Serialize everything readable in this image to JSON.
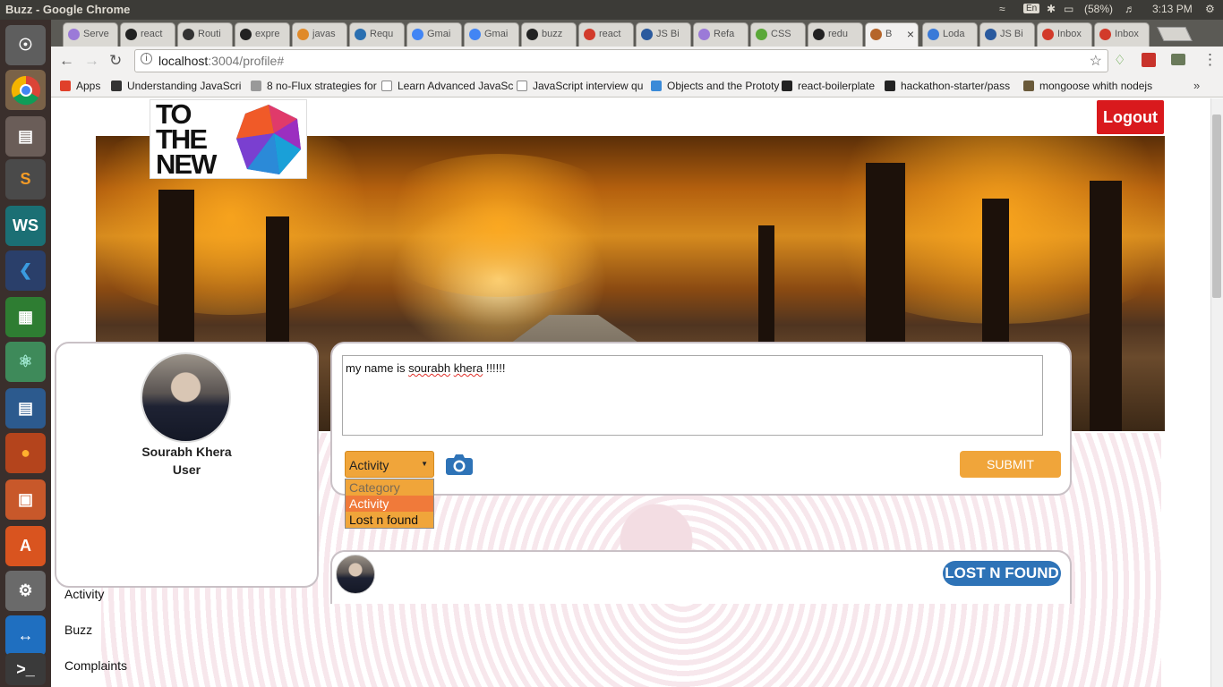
{
  "window": {
    "title": "Buzz - Google Chrome"
  },
  "indicators": {
    "lang": "En",
    "battery": "(58%)",
    "clock": "3:13 PM"
  },
  "tabs": [
    {
      "label": "Serve"
    },
    {
      "label": "react"
    },
    {
      "label": "Routi"
    },
    {
      "label": "expre"
    },
    {
      "label": "javas"
    },
    {
      "label": "Requ"
    },
    {
      "label": "Gmai"
    },
    {
      "label": "Gmai"
    },
    {
      "label": "buzz"
    },
    {
      "label": "react"
    },
    {
      "label": "JS Bi"
    },
    {
      "label": "Refa"
    },
    {
      "label": "CSS"
    },
    {
      "label": "redu"
    },
    {
      "label": "B"
    },
    {
      "label": "Loda"
    },
    {
      "label": "JS Bi"
    },
    {
      "label": "Inbox"
    },
    {
      "label": "Inbox"
    }
  ],
  "address": {
    "host": "localhost",
    "path": ":3004/profile#"
  },
  "bookmarks": [
    {
      "label": "Apps"
    },
    {
      "label": "Understanding JavaScri"
    },
    {
      "label": "8 no-Flux strategies for"
    },
    {
      "label": "Learn Advanced JavaSc"
    },
    {
      "label": "JavaScript interview qu"
    },
    {
      "label": "Objects and the Prototy"
    },
    {
      "label": "react-boilerplate"
    },
    {
      "label": "hackathon-starter/pass"
    },
    {
      "label": "mongoose whith nodejs"
    }
  ],
  "header": {
    "logo_line1": "TO",
    "logo_line2": "THE",
    "logo_line3": "NEW",
    "logout_label": "Logout"
  },
  "profile": {
    "name": "Sourabh Khera",
    "role": "User",
    "nav": [
      {
        "label": "Activity"
      },
      {
        "label": "Buzz"
      },
      {
        "label": "Complaints"
      }
    ]
  },
  "post": {
    "text_before": "my name is ",
    "text_word1": "sourabh",
    "text_space": " ",
    "text_word2": "khera",
    "text_after": " !!!!!!",
    "selected_category": "Activity",
    "options": [
      {
        "label": "Category"
      },
      {
        "label": "Activity"
      },
      {
        "label": "Lost n found"
      }
    ],
    "submit_label": "SUBMIT"
  },
  "feed": {
    "badge": "LOST N FOUND"
  },
  "colors": {
    "logout": "#d9191d",
    "accent": "#f0a53a",
    "badge": "#2e73b7",
    "selected_option": "#f07a3a"
  }
}
